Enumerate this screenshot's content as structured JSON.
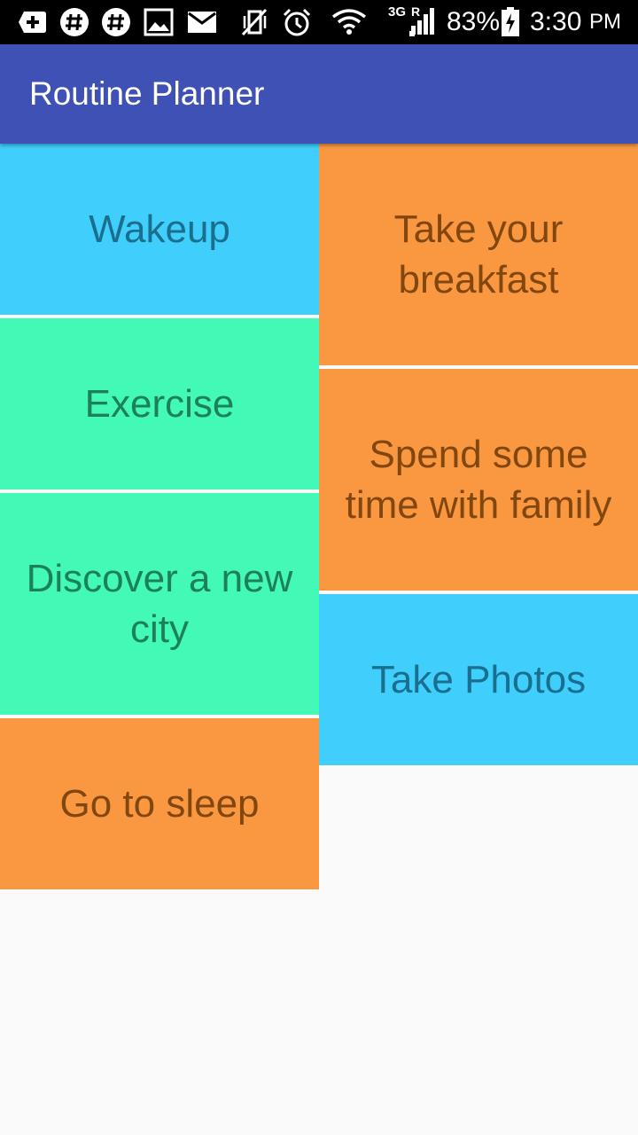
{
  "status_bar": {
    "icons": [
      "add-icon",
      "hashtag-icon",
      "hashtag-icon",
      "image-icon",
      "mail-icon",
      "vibrate-off-icon",
      "alarm-icon",
      "wifi-icon",
      "signal-icon",
      "battery-charging-icon"
    ],
    "network_type": "3G",
    "roaming": "R",
    "battery": "83%",
    "time": "3:30",
    "ampm": "PM"
  },
  "app": {
    "title": "Routine Planner",
    "primary_color": "#3f51b5"
  },
  "colors": {
    "blue": "#40cffc",
    "green": "#42f9b5",
    "orange": "#fa9841"
  },
  "routines": {
    "left": [
      {
        "label": "Wakeup",
        "color": "blue"
      },
      {
        "label": "Exercise",
        "color": "green"
      },
      {
        "label": "Discover a new city",
        "color": "green"
      },
      {
        "label": "Go to sleep",
        "color": "orange"
      }
    ],
    "right": [
      {
        "label": "Take your breakfast",
        "color": "orange"
      },
      {
        "label": "Spend some time with family",
        "color": "orange"
      },
      {
        "label": "Take Photos",
        "color": "blue"
      }
    ]
  }
}
